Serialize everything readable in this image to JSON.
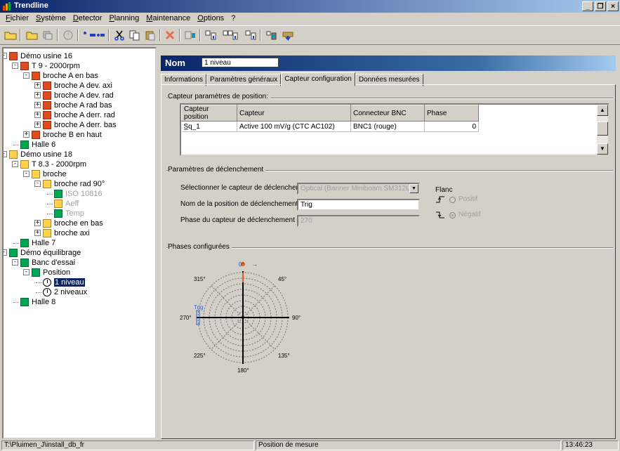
{
  "window": {
    "title": "Trendline",
    "title_color": "#0a246a",
    "buttons": [
      "_",
      "×"
    ]
  },
  "menu": [
    {
      "pre": "",
      "u": "F",
      "post": "ichier"
    },
    {
      "pre": "",
      "u": "S",
      "post": "ystème"
    },
    {
      "pre": "",
      "u": "D",
      "post": "etector"
    },
    {
      "pre": "",
      "u": "P",
      "post": "lanning"
    },
    {
      "pre": "",
      "u": "M",
      "post": "aintenance"
    },
    {
      "pre": "",
      "u": "O",
      "post": "ptions"
    },
    {
      "pre": "",
      "u": "",
      "post": "?"
    }
  ],
  "colors": {
    "status_red": "#e04a1f",
    "status_orange": "#f7a500",
    "status_yellow": "#ffd24a",
    "status_green": "#00a651"
  },
  "tree": {
    "items": [
      {
        "label": "Démo usine 16",
        "icon": "red"
      },
      {
        "label": "T 9 - 2000rpm",
        "icon": "red"
      },
      {
        "label": "broche A en bas",
        "icon": "red"
      },
      {
        "label": "broche A dev. axi",
        "icon": "red"
      },
      {
        "label": "broche A dev. rad",
        "icon": "red"
      },
      {
        "label": "broche A rad bas",
        "icon": "red"
      },
      {
        "label": "broche A derr. rad",
        "icon": "red"
      },
      {
        "label": "broche A derr. bas",
        "icon": "red"
      },
      {
        "label": "broche B en haut",
        "icon": "red"
      },
      {
        "label": "Halle 6",
        "icon": "green"
      },
      {
        "label": "Démo usine 18",
        "icon": "yellow"
      },
      {
        "label": "T 8.3 - 2000rpm",
        "icon": "yellow"
      },
      {
        "label": "broche",
        "icon": "yellow"
      },
      {
        "label": "broche rad 90°",
        "icon": "yellow"
      },
      {
        "label": "ISO 10816",
        "icon": "green"
      },
      {
        "label": "Aeff",
        "icon": "yellow"
      },
      {
        "label": "Temp",
        "icon": "green"
      },
      {
        "label": "broche en bas",
        "icon": "yellow"
      },
      {
        "label": "broche axi",
        "icon": "yellow"
      },
      {
        "label": "Halle 7",
        "icon": "green"
      },
      {
        "label": "Démo équilibrage",
        "icon": "green"
      },
      {
        "label": "Banc d'essai",
        "icon": "green"
      },
      {
        "label": "Position",
        "icon": "green"
      },
      {
        "label": "1 niveau",
        "icon": "clock"
      },
      {
        "label": "2 niveaux",
        "icon": "clock"
      },
      {
        "label": "Halle 8",
        "icon": "green"
      }
    ]
  },
  "nom": {
    "label": "Nom",
    "value": "1 niveau"
  },
  "tabs": [
    "Informations",
    "Paramètres généraux",
    "Capteur configuration",
    "Données mesurées"
  ],
  "active_tab": "Capteur configuration",
  "position_group": {
    "title": "Capteur paramètres de position:",
    "columns": [
      "Capteur position",
      "Capteur",
      "Connecteur BNC",
      "Phase"
    ],
    "rows": [
      [
        "S̲q_1",
        "Active 100 mV/g (CTC AC102)",
        "BNC1 (rouge)",
        "0"
      ]
    ]
  },
  "trigger_group": {
    "title": "Paramètres de déclenchement",
    "select_label": "Sélectionner le capteur de déclenchement",
    "select_value": "Optical (Banner Miniboam SM312LVQD",
    "name_label": "Nom de la position de déclenchement",
    "name_value": "Trig",
    "phase_label": "Phase du capteur de déclenchement",
    "phase_value": "270",
    "flank_label": "Flanc",
    "flank_pos": "Positif",
    "flank_neg": "Négatif"
  },
  "phases_group": {
    "title": "Phases configurées",
    "angles": [
      "0°",
      "45°",
      "90°",
      "135°",
      "180°",
      "225°",
      "270°",
      "315°"
    ],
    "marker_label": "Trig",
    "arrow": "→"
  },
  "status": {
    "path": "T:\\Pluimen_J\\install_db_fr",
    "mode": "Position de mesure",
    "time": "13:46:23"
  }
}
